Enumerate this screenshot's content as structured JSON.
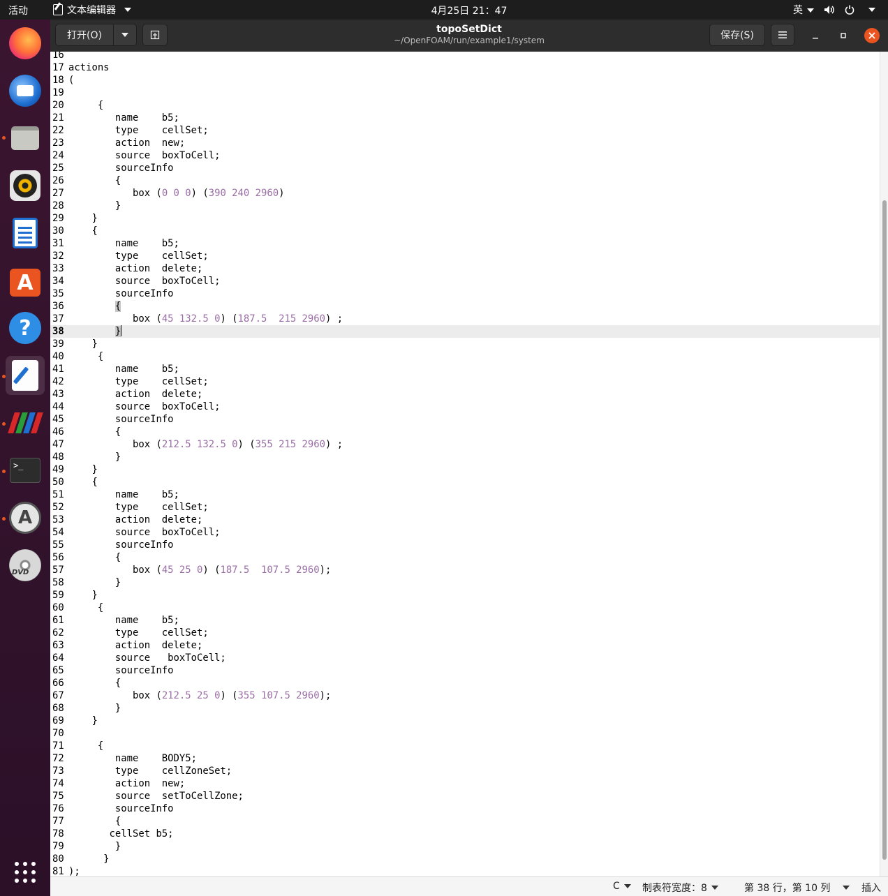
{
  "topbar": {
    "activities": "活动",
    "app_name": "文本编辑器",
    "clock": "4月25日  21：47",
    "input_method": "英"
  },
  "dock": {
    "items": [
      "firefox-icon",
      "thunderbird-icon",
      "files-icon",
      "rhythmbox-icon",
      "writer-icon",
      "software-icon",
      "help-icon",
      "text-editor-icon",
      "paraview-icon",
      "terminal-icon",
      "software-updater-icon",
      "dvd-icon"
    ],
    "show_apps": "show-applications-icon"
  },
  "header": {
    "open_label": "打开(O)",
    "title": "topoSetDict",
    "subtitle": "~/OpenFOAM/run/example1/system",
    "save_label": "保存(S)"
  },
  "editor": {
    "current_line": 38,
    "lines": [
      {
        "n": "16",
        "t": ""
      },
      {
        "n": "17",
        "t": "actions"
      },
      {
        "n": "18",
        "t": "("
      },
      {
        "n": "19",
        "t": ""
      },
      {
        "n": "20",
        "t": "     {"
      },
      {
        "n": "21",
        "t": "        name    b5;"
      },
      {
        "n": "22",
        "t": "        type    cellSet;"
      },
      {
        "n": "23",
        "t": "        action  new;"
      },
      {
        "n": "24",
        "t": "        source  boxToCell;"
      },
      {
        "n": "25",
        "t": "        sourceInfo"
      },
      {
        "n": "26",
        "t": "        {"
      },
      {
        "n": "27",
        "t": "           box (0 0 0) (390 240 2960)"
      },
      {
        "n": "28",
        "t": "        }"
      },
      {
        "n": "29",
        "t": "    }"
      },
      {
        "n": "30",
        "t": "    {"
      },
      {
        "n": "31",
        "t": "        name    b5;"
      },
      {
        "n": "32",
        "t": "        type    cellSet;"
      },
      {
        "n": "33",
        "t": "        action  delete;"
      },
      {
        "n": "34",
        "t": "        source  boxToCell;"
      },
      {
        "n": "35",
        "t": "        sourceInfo"
      },
      {
        "n": "36",
        "t": "        {"
      },
      {
        "n": "37",
        "t": "           box (45 132.5 0) (187.5  215 2960) ;"
      },
      {
        "n": "38",
        "t": "        }"
      },
      {
        "n": "39",
        "t": "    }"
      },
      {
        "n": "40",
        "t": "     {"
      },
      {
        "n": "41",
        "t": "        name    b5;"
      },
      {
        "n": "42",
        "t": "        type    cellSet;"
      },
      {
        "n": "43",
        "t": "        action  delete;"
      },
      {
        "n": "44",
        "t": "        source  boxToCell;"
      },
      {
        "n": "45",
        "t": "        sourceInfo"
      },
      {
        "n": "46",
        "t": "        {"
      },
      {
        "n": "47",
        "t": "           box (212.5 132.5 0) (355 215 2960) ;"
      },
      {
        "n": "48",
        "t": "        }"
      },
      {
        "n": "49",
        "t": "    }"
      },
      {
        "n": "50",
        "t": "    {"
      },
      {
        "n": "51",
        "t": "        name    b5;"
      },
      {
        "n": "52",
        "t": "        type    cellSet;"
      },
      {
        "n": "53",
        "t": "        action  delete;"
      },
      {
        "n": "54",
        "t": "        source  boxToCell;"
      },
      {
        "n": "55",
        "t": "        sourceInfo"
      },
      {
        "n": "56",
        "t": "        {"
      },
      {
        "n": "57",
        "t": "           box (45 25 0) (187.5  107.5 2960);"
      },
      {
        "n": "58",
        "t": "        }"
      },
      {
        "n": "59",
        "t": "    }"
      },
      {
        "n": "60",
        "t": "     {"
      },
      {
        "n": "61",
        "t": "        name    b5;"
      },
      {
        "n": "62",
        "t": "        type    cellSet;"
      },
      {
        "n": "63",
        "t": "        action  delete;"
      },
      {
        "n": "64",
        "t": "        source   boxToCell;"
      },
      {
        "n": "65",
        "t": "        sourceInfo"
      },
      {
        "n": "66",
        "t": "        {"
      },
      {
        "n": "67",
        "t": "           box (212.5 25 0) (355 107.5 2960);"
      },
      {
        "n": "68",
        "t": "        }"
      },
      {
        "n": "69",
        "t": "    }"
      },
      {
        "n": "70",
        "t": ""
      },
      {
        "n": "71",
        "t": "     {"
      },
      {
        "n": "72",
        "t": "        name    BODY5;"
      },
      {
        "n": "73",
        "t": "        type    cellZoneSet;"
      },
      {
        "n": "74",
        "t": "        action  new;"
      },
      {
        "n": "75",
        "t": "        source  setToCellZone;"
      },
      {
        "n": "76",
        "t": "        sourceInfo"
      },
      {
        "n": "77",
        "t": "        {"
      },
      {
        "n": "78",
        "t": "       cellSet b5;"
      },
      {
        "n": "79",
        "t": "        }"
      },
      {
        "n": "80",
        "t": "      }"
      },
      {
        "n": "81",
        "t": ");"
      }
    ]
  },
  "scrollbar": {
    "thumb_start": 0.18,
    "thumb_end": 0.98
  },
  "statusbar": {
    "language": "C",
    "tab_width": "制表符宽度：8",
    "position": "第 38 行，第 10 列",
    "mode": "插入"
  }
}
